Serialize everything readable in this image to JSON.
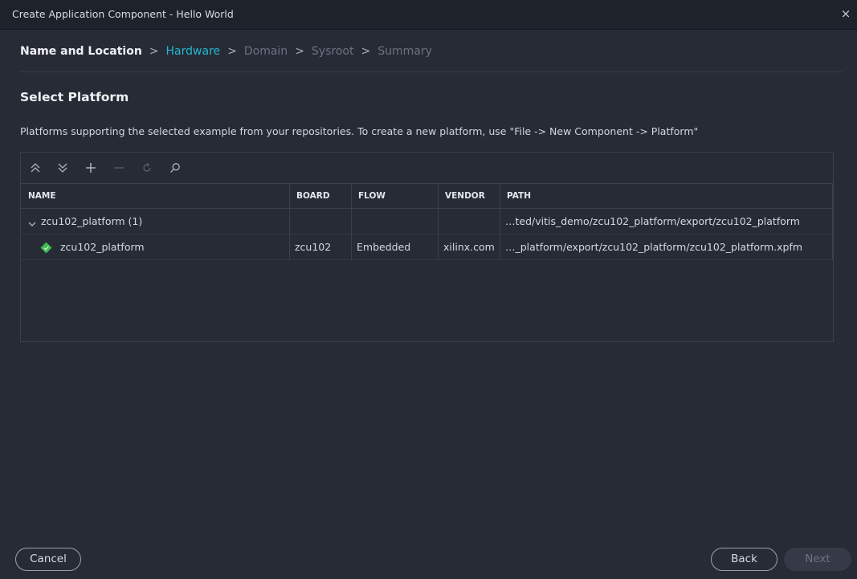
{
  "window": {
    "title": "Create Application Component - Hello World",
    "close_glyph": "×"
  },
  "breadcrumb": {
    "steps": [
      {
        "label": "Name and Location",
        "state": "done"
      },
      {
        "label": "Hardware",
        "state": "active"
      },
      {
        "label": "Domain",
        "state": "pending"
      },
      {
        "label": "Sysroot",
        "state": "pending"
      },
      {
        "label": "Summary",
        "state": "pending"
      }
    ],
    "separator": ">"
  },
  "section": {
    "title": "Select Platform",
    "description": "Platforms supporting the selected example from your repositories. To create a new platform, use \"File -> New Component -> Platform\""
  },
  "toolbar": {
    "icons": [
      "collapse-all-icon",
      "expand-all-icon",
      "add-icon",
      "remove-icon",
      "refresh-icon",
      "search-icon"
    ]
  },
  "table": {
    "columns": [
      "NAME",
      "BOARD",
      "FLOW",
      "VENDOR",
      "PATH"
    ],
    "rows": [
      {
        "name": "zcu102_platform (1)",
        "board": "",
        "flow": "",
        "vendor": "",
        "path": "…ted/vitis_demo/zcu102_platform/export/zcu102_platform",
        "expanded": true,
        "level": 0
      },
      {
        "name": "zcu102_platform",
        "board": "zcu102",
        "flow": "Embedded",
        "vendor": "xilinx.com",
        "path": "…_platform/export/zcu102_platform/zcu102_platform.xpfm",
        "level": 1,
        "icon": "platform-icon"
      }
    ]
  },
  "buttons": {
    "cancel": "Cancel",
    "back": "Back",
    "next": "Next"
  },
  "colors": {
    "accent": "#26b9d1",
    "background": "#262b36",
    "platform_icon": "#3fb950"
  }
}
